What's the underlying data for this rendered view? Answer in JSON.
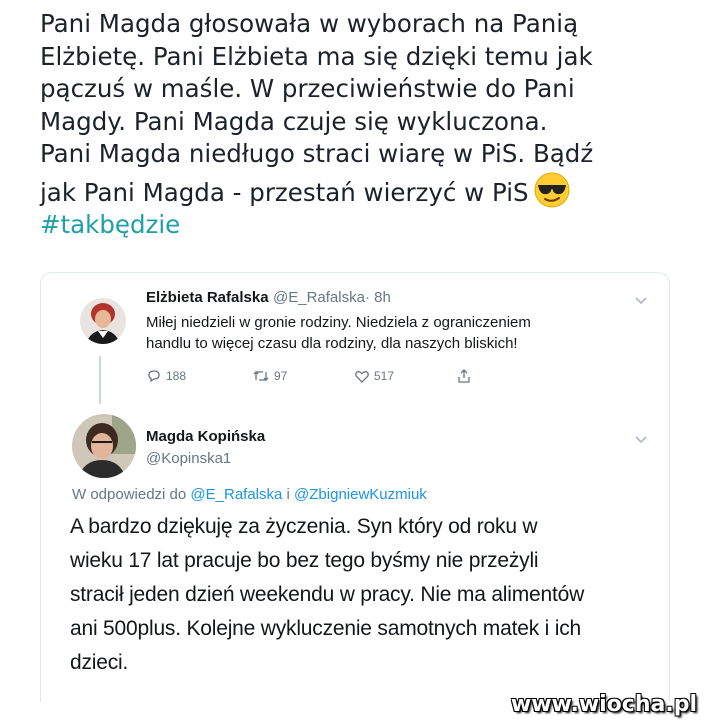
{
  "post": {
    "text": "Pani Magda głosowała w wyborach na Panią\nElżbietę. Pani Elżbieta ma się dzięki temu jak\npączuś w maśle. W przeciwieństwie do Pani\nMagdy. Pani Magda czuje się wykluczona.\nPani Magda niedługo straci wiarę w PiS. Bądź\njak Pani Magda - przestań wierzyć w PiS",
    "emoji": "smiling-face-with-sunglasses",
    "hashtag": "#takbędzie",
    "hashtag_color": "#1da1a4"
  },
  "tweet1": {
    "name": "Elżbieta Rafalska",
    "handle": "@E_Rafalska",
    "time": "· 8h",
    "text": "Miłej niedzieli w gronie rodziny. Niedziela z ograniczeniem\nhandlu to więcej czasu dla rodziny, dla naszych bliskich!",
    "replies": "188",
    "retweets": "97",
    "likes": "517"
  },
  "tweet2": {
    "name": "Magda Kopińska",
    "handle": "@Kopinska1",
    "reply_prefix": "W odpowiedzi do",
    "reply_to_1": "@E_Rafalska",
    "reply_and": "i",
    "reply_to_2": "@ZbigniewKuzmiuk",
    "text": "A bardzo dziękuję za życzenia. Syn który od roku w\nwieku 17 lat pracuje bo bez tego byśmy nie przeżyli\nstracił jeden dzień weekendu w pracy. Nie ma alimentów\nani 500plus. Kolejne wykluczenie samotnych matek i ich\ndzieci."
  },
  "watermark": "www.wiocha.pl",
  "colors": {
    "link": "#1b95e0",
    "muted": "#657786",
    "border": "#e1e8ed"
  }
}
